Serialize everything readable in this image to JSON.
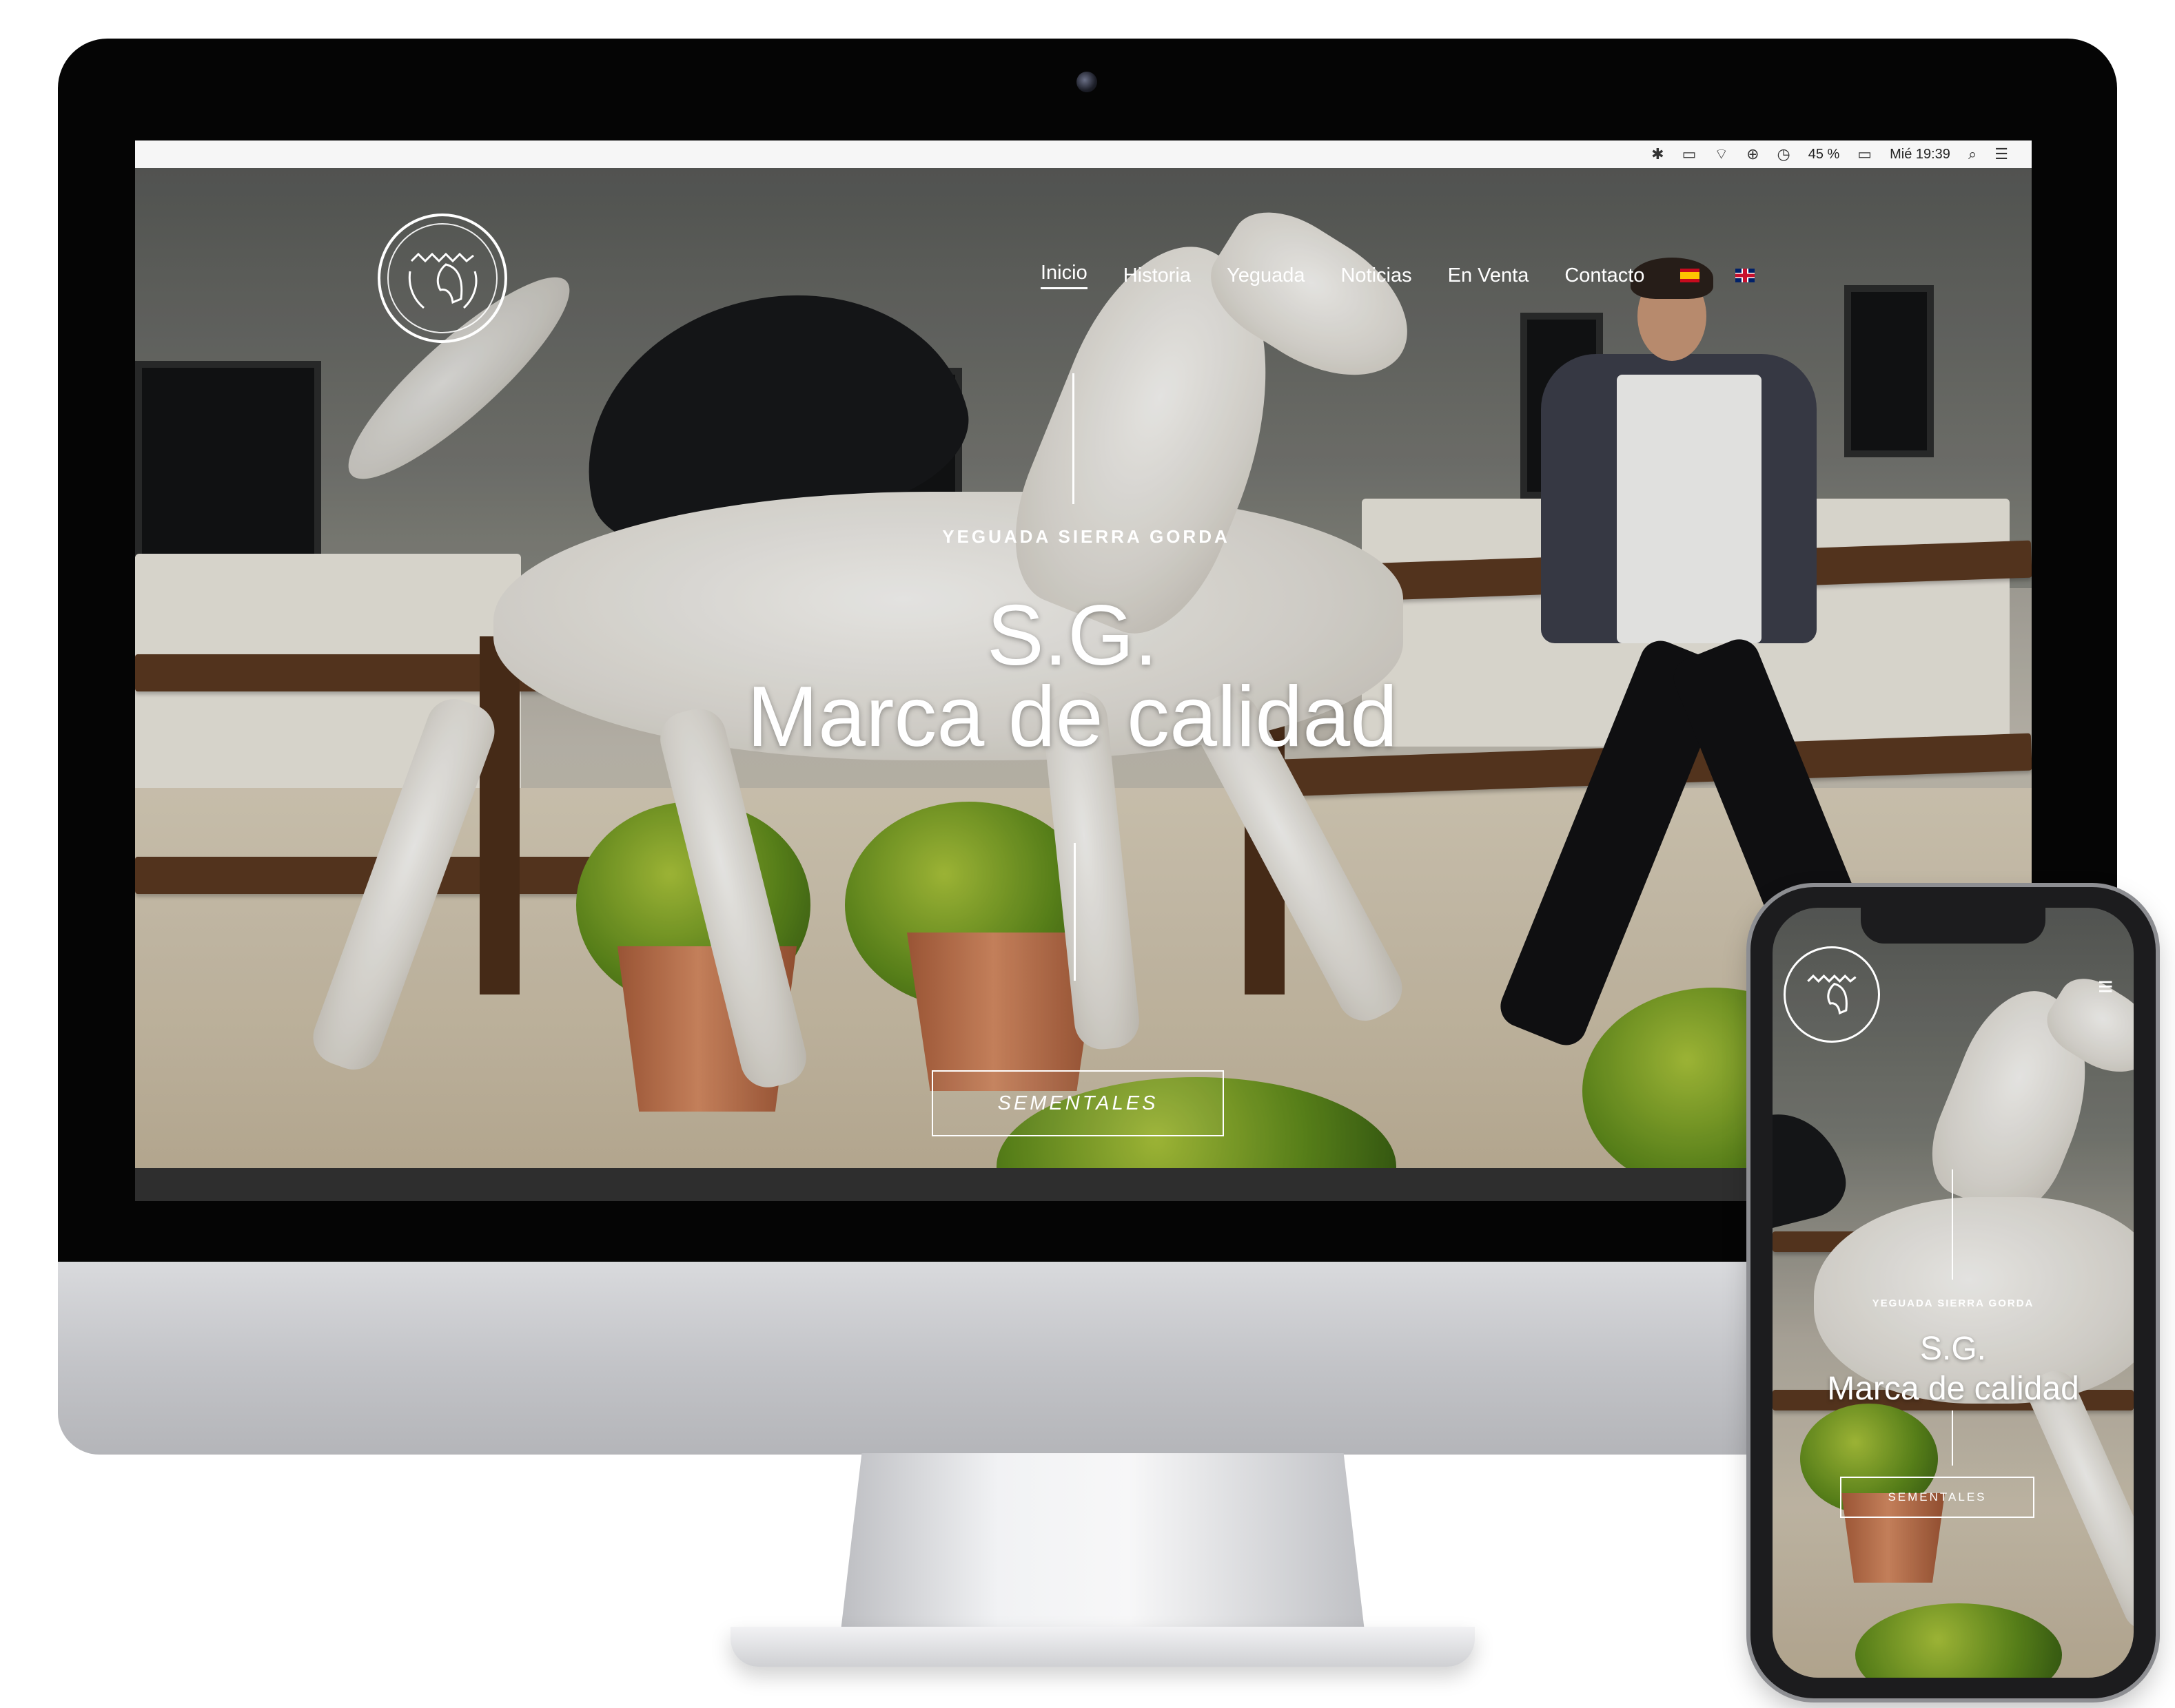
{
  "menubar": {
    "battery": "45 %",
    "clock": "Mié 19:39"
  },
  "site": {
    "nav": [
      "Inicio",
      "Historia",
      "Yeguada",
      "Noticias",
      "En Venta",
      "Contacto"
    ],
    "eyebrow": "YEGUADA SIERRA GORDA",
    "headline_line1": "S.G.",
    "headline_line2": "Marca de calidad",
    "cta": "SEMENTALES",
    "languages": [
      "es-flag-icon",
      "uk-flag-icon"
    ]
  },
  "mobile": {
    "eyebrow": "YEGUADA SIERRA GORDA",
    "headline_line1": "S.G.",
    "headline_line2": "Marca de calidad",
    "cta": "SEMENTALES",
    "menu_icon": "hamburger-icon"
  },
  "colors": {
    "text": "#ffffff",
    "bezel": "#050505"
  }
}
